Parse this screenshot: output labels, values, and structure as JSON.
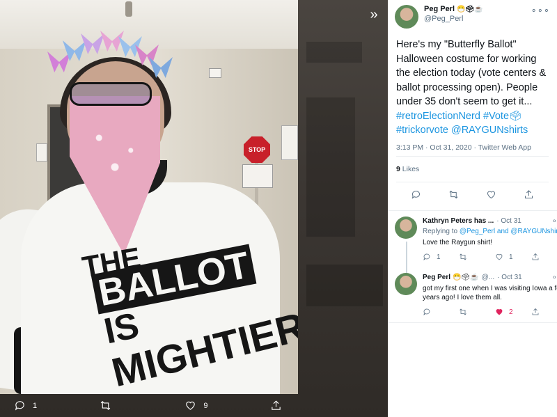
{
  "media": {
    "actions": {
      "reply_count": "1",
      "retweet_count": "",
      "like_count": "9"
    },
    "shirt_text": {
      "line1": "THE",
      "line2": "BALLOT",
      "line3": "IS",
      "line4": "MIGHTIER"
    },
    "stop_sign": "STOP"
  },
  "tweet": {
    "author_name": "Peg Perl",
    "author_emoji": "😷🗳☕",
    "author_handle": "@Peg_Perl",
    "text_plain": "Here's my \"Butterfly Ballot\" Halloween costume for working the election today (vote centers & ballot processing open). People under 35 don't seem to get it...",
    "hashtag1": "#retroElectionNerd",
    "hashtag2": "#Vote🗳",
    "hashtag3": "#trickorvote",
    "mention": "@RAYGUNshirts",
    "timestamp": "3:13 PM · Oct 31, 2020 · Twitter Web App",
    "likes_count": "9",
    "likes_label": "Likes"
  },
  "replies": [
    {
      "name": "Kathryn Peters has ...",
      "handle": "",
      "time": "· Oct 31",
      "replying_prefix": "Replying to",
      "replying_to": "@Peg_Perl and @RAYGUNshirts",
      "text": "Love the Raygun shirt!",
      "reply_count": "1",
      "retweet_count": "",
      "like_count": "1"
    },
    {
      "name": "Peg Perl",
      "emoji": "😷🗳☕",
      "handle": "@...",
      "time": "· Oct 31",
      "text": "got my first one when I was visiting Iowa a few years ago!  I love them all.",
      "reply_count": "",
      "retweet_count": "",
      "like_count": "2"
    }
  ],
  "colors": {
    "accent": "#1b95e0",
    "like": "#e0245e",
    "muted": "#5b7083"
  },
  "icons": [
    "reply-icon",
    "retweet-icon",
    "like-icon",
    "share-icon",
    "more-icon",
    "expand-icon"
  ]
}
